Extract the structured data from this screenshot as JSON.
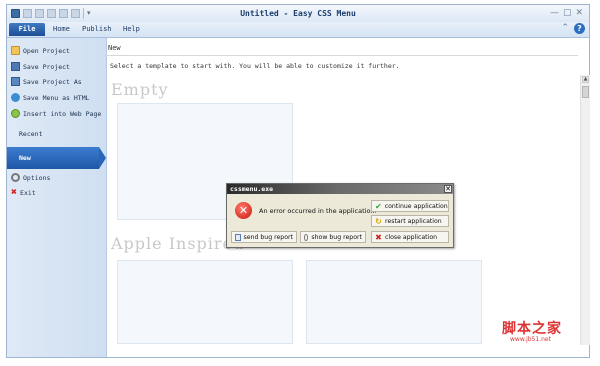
{
  "window": {
    "title": "Untitled - Easy CSS Menu",
    "controls": [
      "—",
      "▢",
      "✕"
    ]
  },
  "ribbon": {
    "tabs": [
      {
        "label": "File",
        "active": true
      },
      {
        "label": "Home"
      },
      {
        "label": "Publish"
      },
      {
        "label": "Help"
      }
    ],
    "minimize_label": "⌃",
    "help_label": "?"
  },
  "sidebar": {
    "items": [
      {
        "label": "Open Project",
        "icon": "folder-icon"
      },
      {
        "label": "Save Project",
        "icon": "save-icon"
      },
      {
        "label": "Save Project As",
        "icon": "save-as-icon"
      },
      {
        "label": "Save Menu as HTML",
        "icon": "html-icon"
      },
      {
        "label": "Insert into Web Page",
        "icon": "web-page-icon"
      }
    ],
    "recent_label": "Recent",
    "new_label": "New",
    "options_label": "Options",
    "exit_label": "Exit"
  },
  "main": {
    "heading": "New",
    "description": "Select a template to start with. You will be able to customize it further.",
    "sections": [
      {
        "title": "Empty"
      },
      {
        "title": "Apple Inspired"
      }
    ]
  },
  "dialog": {
    "title": "cssmenu.exe",
    "close_label": "✕",
    "message": "An error occurred in the application.",
    "buttons": {
      "send_bug_report": "send bug report",
      "show_bug_report": "show bug report",
      "continue": "continue application",
      "restart": "restart application",
      "close": "close application"
    }
  },
  "watermark": {
    "text": "脚本之家",
    "url": "www.jb51.net"
  },
  "colors": {
    "accent": "#2a66b8",
    "error": "#c8160c"
  }
}
